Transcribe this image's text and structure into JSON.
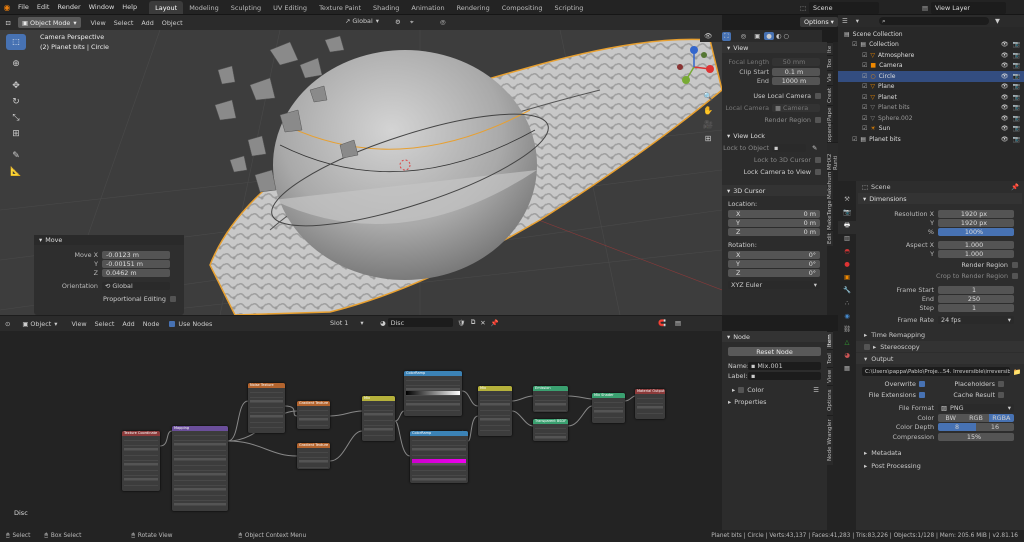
{
  "menu": [
    "File",
    "Edit",
    "Render",
    "Window",
    "Help"
  ],
  "workspaces": [
    "Layout",
    "Modeling",
    "Sculpting",
    "UV Editing",
    "Texture Paint",
    "Shading",
    "Animation",
    "Rendering",
    "Compositing",
    "Scripting"
  ],
  "scene_name": "Scene",
  "view_layer": "View Layer",
  "viewport": {
    "mode": "Object Mode",
    "menus": [
      "View",
      "Select",
      "Add",
      "Object"
    ],
    "transform": "Global",
    "options": "Options",
    "overlay_title": "Camera Perspective",
    "overlay_sub": "(2) Planet bits | Circle",
    "move": {
      "title": "Move",
      "x_label": "Move X",
      "x": "-0.0123 m",
      "y_label": "Y",
      "y": "-0.00151 m",
      "z_label": "Z",
      "z": "0.0462 m",
      "orient_label": "Orientation",
      "orient": "Global",
      "prop": "Proportional Editing"
    }
  },
  "npanel": {
    "view_title": "View",
    "focal_label": "Focal Length",
    "focal": "50 mm",
    "clip_start_label": "Clip Start",
    "clip_start": "0.1 m",
    "end_label": "End",
    "end": "1000 m",
    "local_cam": "Use Local Camera",
    "local_camera_label": "Local Camera",
    "local_camera": "Camera",
    "render_region": "Render Region",
    "viewlock_title": "View Lock",
    "lock_obj": "Lock to Object",
    "lock_cursor": "Lock to 3D Cursor",
    "lock_cam": "Lock Camera to View",
    "cursor_title": "3D Cursor",
    "location": "Location:",
    "x": "X",
    "y": "Y",
    "z": "Z",
    "loc_x": "0 m",
    "loc_y": "0 m",
    "loc_z": "0 m",
    "rotation": "Rotation:",
    "rot_x": "0°",
    "rot_y": "0°",
    "rot_z": "0°",
    "euler": "XYZ Euler",
    "tabs": [
      "Ite",
      "Too",
      "Vie",
      "Creat",
      "Pape",
      "popanel",
      "MHX2 Runti",
      "Makehum",
      "MakeTarge",
      "Edit"
    ]
  },
  "outliner": {
    "search_placeholder": "",
    "items": [
      {
        "name": "Scene Collection"
      },
      {
        "name": "Collection"
      },
      {
        "name": "Atmosphere"
      },
      {
        "name": "Camera"
      },
      {
        "name": "Circle"
      },
      {
        "name": "Plane"
      },
      {
        "name": "Planet"
      },
      {
        "name": "Planet bits"
      },
      {
        "name": "Sphere.002"
      },
      {
        "name": "Sun"
      },
      {
        "name": "Planet bits"
      }
    ]
  },
  "props": {
    "scene": "Scene",
    "dimensions": "Dimensions",
    "res_x_label": "Resolution X",
    "res_x": "1920 px",
    "y_label": "Y",
    "res_y": "1920 px",
    "pct_label": "%",
    "pct": "100%",
    "aspect_label": "Aspect X",
    "aspect_x": "1.000",
    "aspect_y": "1.000",
    "render_region": "Render Region",
    "crop": "Crop to Render Region",
    "fstart_label": "Frame Start",
    "fstart": "1",
    "fend_label": "End",
    "fend": "250",
    "step_label": "Step",
    "step": "1",
    "frate_label": "Frame Rate",
    "frate": "24 fps",
    "time_remap": "Time Remapping",
    "stereo": "Stereoscopy",
    "output": "Output",
    "path": "C:\\Users\\pappa\\Pablo\\Proje...54. Irreversible\\irreversible",
    "overwrite": "Overwrite",
    "placeholders": "Placeholders",
    "fileext": "File Extensions",
    "cache": "Cache Result",
    "ff_label": "File Format",
    "ff": "PNG",
    "color_label": "Color",
    "bw": "BW",
    "rgb": "RGB",
    "rgba": "RGBA",
    "depth_label": "Color Depth",
    "d8": "8",
    "d16": "16",
    "comp_label": "Compression",
    "comp": "15%",
    "metadata": "Metadata",
    "post": "Post Processing"
  },
  "nodeeditor": {
    "type": "Object",
    "menus": [
      "View",
      "Select",
      "Add",
      "Node"
    ],
    "use_nodes": "Use Nodes",
    "slot": "Slot 1",
    "material": "Disc",
    "label": "Disc",
    "side": {
      "title": "Node",
      "reset": "Reset Node",
      "name_label": "Name:",
      "name": "Mix.001",
      "label_label": "Label:",
      "color": "Color",
      "properties": "Properties"
    },
    "tabs": [
      "Item",
      "Tool",
      "View",
      "Options",
      "Node Wrangler"
    ],
    "nodes": [
      {
        "t": "Texture Coordinate",
        "c": "#8b3a3a"
      },
      {
        "t": "Mapping",
        "c": "#6a4e9a"
      },
      {
        "t": "Noise Texture",
        "c": "#b3642e"
      },
      {
        "t": "Gradient Texture",
        "c": "#b3642e"
      },
      {
        "t": "Gradient Texture",
        "c": "#b3642e"
      },
      {
        "t": "Mix",
        "c": "#b5b13b"
      },
      {
        "t": "ColorRamp",
        "c": "#3b82b5"
      },
      {
        "t": "ColorRamp",
        "c": "#3b82b5"
      },
      {
        "t": "Mix",
        "c": "#b5b13b"
      },
      {
        "t": "Emission",
        "c": "#3aa070"
      },
      {
        "t": "Transparent BSDF",
        "c": "#3aa070"
      },
      {
        "t": "Mix Shader",
        "c": "#3aa070"
      },
      {
        "t": "Material Output",
        "c": "#8b3a3a"
      }
    ]
  },
  "status": {
    "select": "Select",
    "box": "Box Select",
    "rotate": "Rotate View",
    "ctx": "Object Context Menu",
    "info": "Planet bits | Circle | Verts:43,137 | Faces:41,283 | Tris:83,226 | Objects:1/128 | Mem: 205.6 MiB | v2.81.16"
  }
}
